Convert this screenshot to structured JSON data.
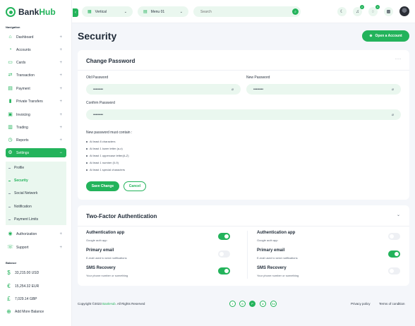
{
  "app": {
    "brand_prefix": "Bank",
    "brand_suffix": "Hub"
  },
  "sidebar": {
    "navigation_label": "Navigation",
    "items": [
      {
        "label": "Dashboard",
        "icon": "home-icon"
      },
      {
        "label": "Accounts",
        "icon": "user-icon"
      },
      {
        "label": "Cards",
        "icon": "card-icon"
      },
      {
        "label": "Transaction",
        "icon": "transfer-icon"
      },
      {
        "label": "Payment",
        "icon": "payment-icon"
      },
      {
        "label": "Private Transfers",
        "icon": "bar-chart-icon"
      },
      {
        "label": "Invoicing",
        "icon": "invoice-icon"
      },
      {
        "label": "Trading",
        "icon": "trading-icon"
      },
      {
        "label": "Reports",
        "icon": "report-icon"
      },
      {
        "label": "Settings",
        "icon": "gear-icon",
        "active": true
      }
    ],
    "settings_submenu": [
      {
        "label": "Profile"
      },
      {
        "label": "Security",
        "active": true
      },
      {
        "label": "Social Network"
      },
      {
        "label": "Notification"
      },
      {
        "label": "Payment Limits"
      }
    ],
    "lower_items": [
      {
        "label": "Authorization",
        "icon": "lock-icon"
      },
      {
        "label": "Support",
        "icon": "support-icon"
      }
    ],
    "balance_label": "Balance",
    "balances": [
      {
        "label": "33,215.00 USD",
        "icon": "dollar-icon"
      },
      {
        "label": "15,254.32 EUR",
        "icon": "euro-icon"
      },
      {
        "label": "7,029.14 GBP",
        "icon": "pound-icon"
      }
    ],
    "add_balance_label": "Add More Balance"
  },
  "topbar": {
    "layout_select": "Vertical",
    "menu_select": "Menu 01",
    "search_placeholder": "Search",
    "notification_count": "2",
    "message_count": "3"
  },
  "page": {
    "title": "Security",
    "open_account_label": "Open a Account"
  },
  "change_password": {
    "title": "Change Password",
    "old_label": "Old Password",
    "old_value": "••••••••",
    "new_label": "New Password",
    "new_value": "••••••••",
    "confirm_label": "Confirm Password",
    "confirm_value": "••••••••",
    "requirements_heading": "New password must contain :",
    "requirements": [
      "At least 8 characters",
      "At least 1 lower letter (a-z)",
      "At least 1 uppercase letter(A-Z)",
      "At least 1 number (0-9)",
      "At least 1 special characters"
    ],
    "save_label": "Save Change",
    "cancel_label": "Cancel"
  },
  "two_factor": {
    "title": "Two-Factor Authentication",
    "left": [
      {
        "title": "Authentication app",
        "desc": "Google auth app",
        "enabled": true
      },
      {
        "title": "Primary email",
        "desc": "E-mail used to send notifications",
        "enabled": false
      },
      {
        "title": "SMS Recovery",
        "desc": "Your phone number or something",
        "enabled": true
      }
    ],
    "right": [
      {
        "title": "Authentication app",
        "desc": "Google auth app",
        "enabled": false
      },
      {
        "title": "Primary email",
        "desc": "E-mail used to send notifications",
        "enabled": true
      },
      {
        "title": "SMS Recovery",
        "desc": "Your phone number or something",
        "enabled": false
      }
    ]
  },
  "footer": {
    "copyright_prefix": "Copyright ©2023 ",
    "copyright_brand": "BankHub",
    "copyright_suffix": ". All Rights Reserved",
    "social": [
      {
        "glyph": "f",
        "icon": "facebook-icon"
      },
      {
        "glyph": "◎",
        "icon": "instagram-icon"
      },
      {
        "glyph": "P",
        "icon": "pinterest-icon"
      },
      {
        "glyph": "●",
        "icon": "dribbble-icon"
      },
      {
        "glyph": "Be",
        "icon": "behance-icon"
      }
    ],
    "privacy_label": "Privacy policy",
    "terms_label": "Terms of condition"
  },
  "colors": {
    "accent": "#23b35b",
    "accent_light": "#eaf7ef",
    "background": "#f4f6fa"
  }
}
